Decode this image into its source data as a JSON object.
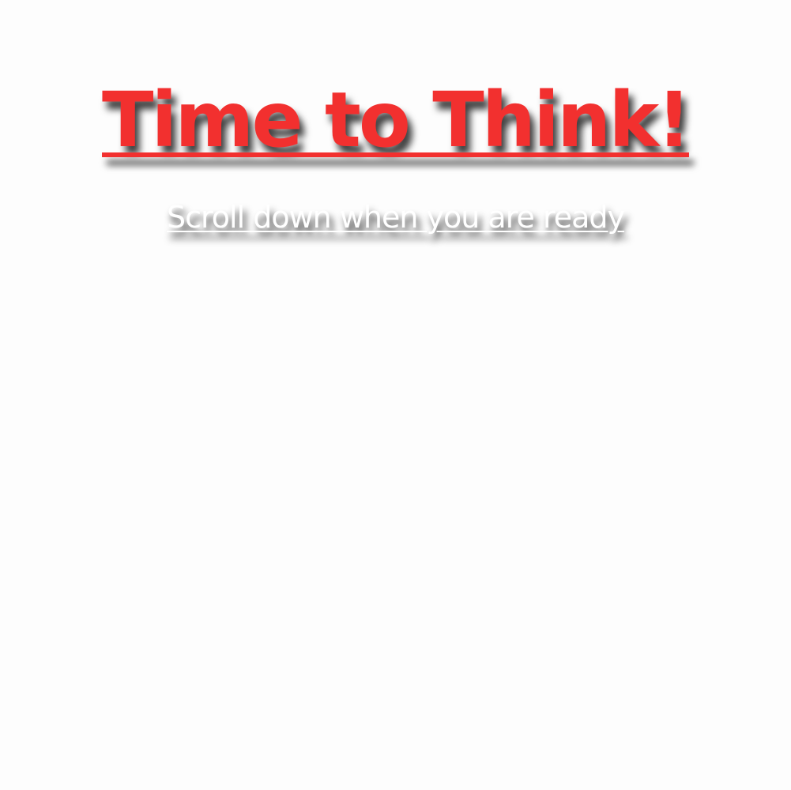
{
  "hero": {
    "title": "Time to Think!",
    "subtitle": "Scroll down when you are ready"
  },
  "colors": {
    "background": "#fdfdfd",
    "title": "#f2302f",
    "subtitle": "#ffffff"
  }
}
